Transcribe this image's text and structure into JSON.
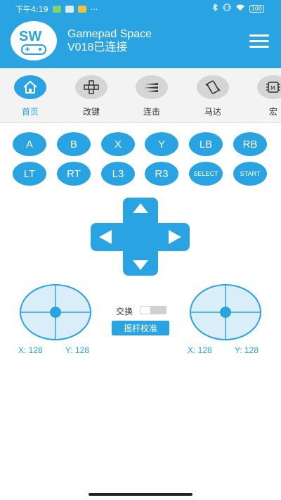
{
  "status_bar": {
    "time": "下午4:19",
    "battery": "100",
    "dots": "···"
  },
  "header": {
    "title_line1": "Gamepad Space",
    "title_line2": "V018已连接",
    "logo_text": "SW"
  },
  "tabs": [
    {
      "label": "首页",
      "icon": "home-icon",
      "active": true
    },
    {
      "label": "改键",
      "icon": "remap-icon",
      "active": false
    },
    {
      "label": "连击",
      "icon": "turbo-icon",
      "active": false
    },
    {
      "label": "马达",
      "icon": "vibration-icon",
      "active": false
    },
    {
      "label": "宏",
      "icon": "chip-icon",
      "active": false
    }
  ],
  "buttons": {
    "row1": [
      "A",
      "B",
      "X",
      "Y",
      "LB",
      "RB"
    ],
    "row2": [
      "LT",
      "RT",
      "L3",
      "R3",
      "SELECT",
      "START"
    ]
  },
  "left_stick": {
    "x_label": "X: 128",
    "y_label": "Y: 128"
  },
  "right_stick": {
    "x_label": "X: 128",
    "y_label": "Y: 128"
  },
  "swap": {
    "label": "交换",
    "on": false
  },
  "calibrate_label": "摇杆校准",
  "colors": {
    "accent": "#2aa3e3",
    "tab_bg": "#f3f3f3",
    "inactive_icon": "#d5d5d5"
  }
}
